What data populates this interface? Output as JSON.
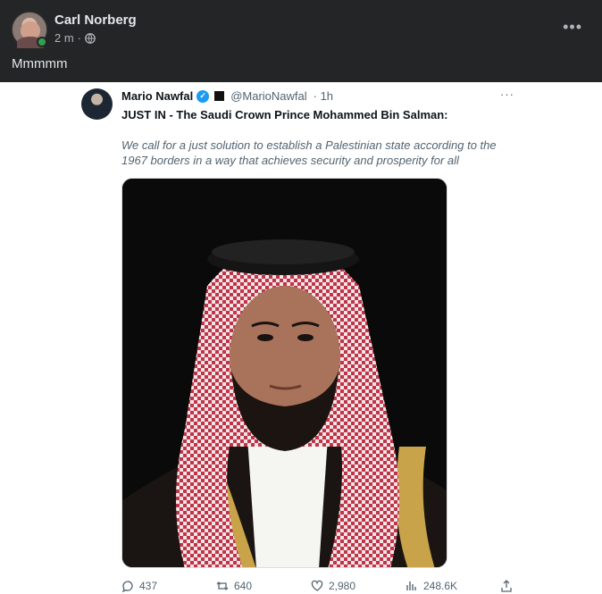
{
  "post": {
    "author": "Carl Norberg",
    "time": "2 m",
    "separator": "·",
    "text": "Mmmmm",
    "more": "•••"
  },
  "tweet": {
    "name": "Mario Nawfal",
    "handle": "@MarioNawfal",
    "time": "· 1h",
    "more": "···",
    "headline": "JUST IN - The Saudi Crown Prince Mohammed Bin Salman:",
    "quote": "We call for a just solution to establish a Palestinian state according to the 1967 borders in a way that achieves security and prosperity for all",
    "stats": {
      "replies": "437",
      "reposts": "640",
      "likes": "2,980",
      "views": "248.6K"
    }
  },
  "icons": [
    "globe-icon",
    "more-icon",
    "verified-icon",
    "reply-icon",
    "repost-icon",
    "like-icon",
    "views-icon",
    "share-icon"
  ],
  "colors": {
    "fb_bg": "#242526",
    "online": "#31a24c",
    "verified": "#1d9bf0"
  }
}
